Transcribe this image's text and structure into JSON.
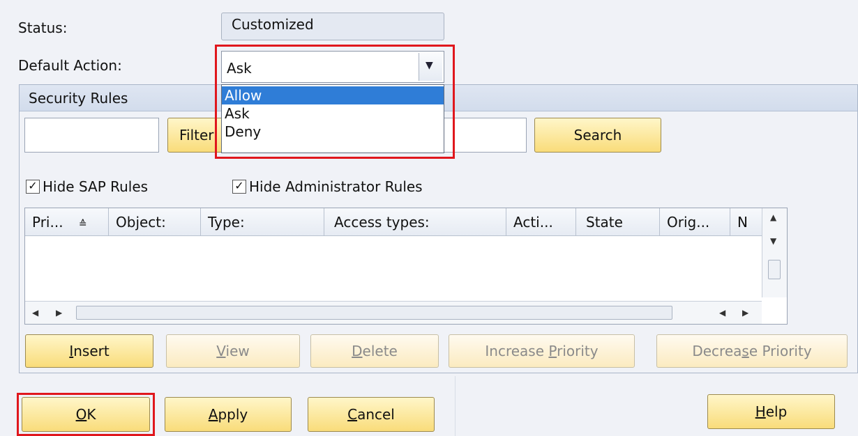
{
  "status": {
    "label": "Status:",
    "value": "Customized"
  },
  "default_action": {
    "label": "Default Action:",
    "selected": "Ask",
    "options": [
      "Allow",
      "Ask",
      "Deny"
    ],
    "highlighted": "Allow"
  },
  "security_rules": {
    "title": "Security Rules",
    "filter_button": "Filter",
    "search_button": "Search",
    "hide_sap_rules": {
      "label": "Hide SAP Rules",
      "checked": true
    },
    "hide_admin_rules": {
      "label": "Hide Administrator Rules",
      "checked": true
    },
    "columns": [
      "Pri...",
      "Object:",
      "Type:",
      "Access types:",
      "Acti...",
      "State",
      "Orig...",
      "N"
    ],
    "buttons": {
      "insert": {
        "pre": "",
        "key": "I",
        "post": "nsert"
      },
      "view": {
        "pre": "",
        "key": "V",
        "post": "iew"
      },
      "delete": {
        "pre": "",
        "key": "D",
        "post": "elete"
      },
      "increase": {
        "pre": "Increase ",
        "key": "P",
        "post": "riority"
      },
      "decrease": {
        "pre": "Decrea",
        "key": "s",
        "post": "e Priority"
      }
    }
  },
  "footer": {
    "ok": {
      "pre": "",
      "key": "O",
      "post": "K"
    },
    "apply": {
      "pre": "",
      "key": "A",
      "post": "pply"
    },
    "cancel": {
      "pre": "",
      "key": "C",
      "post": "ancel"
    },
    "help": {
      "pre": "",
      "key": "H",
      "post": "elp"
    }
  },
  "colors": {
    "highlight_box": "#e0171d",
    "selection": "#2f7dd7",
    "button_face": "#f9dc7a"
  },
  "icons": {
    "sort": "sort-ascending-icon",
    "dropdown": "chevron-down-icon",
    "scroll_up": "scroll-up-icon",
    "scroll_down": "scroll-down-icon",
    "scroll_left": "scroll-left-icon",
    "scroll_right": "scroll-right-icon"
  }
}
